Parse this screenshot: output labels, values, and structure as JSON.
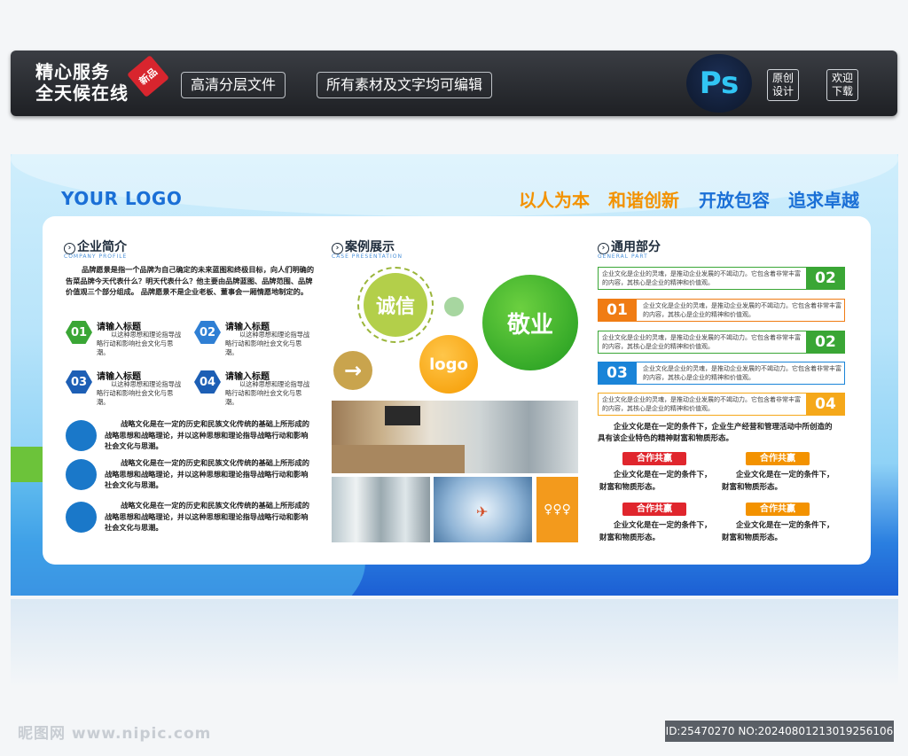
{
  "topbar": {
    "slogan1": "精心服务",
    "slogan2": "全天候在线",
    "new_badge": "新品",
    "pill1": "高清分层文件",
    "pill2": "所有素材及文字均可编辑",
    "ps": "Ps",
    "btn_original_1": "原创",
    "btn_original_2": "设计",
    "btn_download_1": "欢迎",
    "btn_download_2": "下载"
  },
  "board": {
    "logo": "YOUR LOGO",
    "slogans": [
      "以人为本",
      "和谐创新",
      "开放包容",
      "追求卓越"
    ],
    "slogan_colors": [
      "#f39200",
      "#f39200",
      "#1a6fd6",
      "#1a6fd6"
    ]
  },
  "left": {
    "title": "企业简介",
    "subtitle": "COMPANY PROFILE",
    "intro": "品牌愿景是指一个品牌为自己确定的未来蓝图和终极目标，向人们明确的告菜品牌今天代表什么？明天代表什么？他主要由品牌蓝图、品牌范围、品牌价值观三个部分组成。 品牌愿景不是企业老板、董事会一厢情愿地制定的。",
    "items": [
      {
        "num": "01",
        "title": "请输入标题",
        "body": "以这种思想和理论指导战略行动和影响社会文化与思潮。",
        "color": "#3aa635"
      },
      {
        "num": "02",
        "title": "请输入标题",
        "body": "以这种思想和理论指导战略行动和影响社会文化与思潮。",
        "color": "#2f7fd4"
      },
      {
        "num": "03",
        "title": "请输入标题",
        "body": "以这种思想和理论指导战略行动和影响社会文化与思潮。",
        "color": "#1d5fb5"
      },
      {
        "num": "04",
        "title": "请输入标题",
        "body": "以这种思想和理论指导战略行动和影响社会文化与思潮。",
        "color": "#1d5fb5"
      }
    ],
    "paras": [
      "战略文化是在一定的历史和民族文化传统的基础上所形成的战略思想和战略理论，并以这种思想和理论指导战略行动和影响社会文化与思潮。",
      "战略文化是在一定的历史和民族文化传统的基础上所形成的战略思想和战略理论，并以这种思想和理论指导战略行动和影响社会文化与思潮。",
      "战略文化是在一定的历史和民族文化传统的基础上所形成的战略思想和战略理论，并以这种思想和理论指导战略行动和影响社会文化与思潮。"
    ]
  },
  "middle": {
    "title": "案例展示",
    "subtitle": "CASE PRESENTATION",
    "circle1": "诚信",
    "circle2": "敬业",
    "circle3": "logo",
    "arrow": "→"
  },
  "right": {
    "title": "通用部分",
    "subtitle": "GENERAL PART",
    "boxes": [
      {
        "num": "02",
        "text": "企业文化是企业的灵魂，是推动企业发展的不竭动力。它包含着非常丰富的内容，其核心是企业的精神和价值观。",
        "color": "#3aa635",
        "side": "right"
      },
      {
        "num": "01",
        "text": "企业文化是企业的灵魂，是推动企业发展的不竭动力。它包含着非常丰富的内容，其核心是企业的精神和价值观。",
        "color": "#f07c14",
        "side": "left"
      },
      {
        "num": "02",
        "text": "企业文化是企业的灵魂，是推动企业发展的不竭动力。它包含着非常丰富的内容，其核心是企业的精神和价值观。",
        "color": "#3aa635",
        "side": "right"
      },
      {
        "num": "03",
        "text": "企业文化是企业的灵魂，是推动企业发展的不竭动力。它包含着非常丰富的内容，其核心是企业的精神和价值观。",
        "color": "#1a84d8",
        "side": "left"
      },
      {
        "num": "04",
        "text": "企业文化是企业的灵魂，是推动企业发展的不竭动力。它包含着非常丰富的内容，其核心是企业的精神和价值观。",
        "color": "#f5a81a",
        "side": "right"
      }
    ],
    "summary": "企业文化是在一定的条件下，企业生产经营和管理活动中所创造的具有该企业特色的精神财富和物质形态。",
    "tags": [
      {
        "label": "合作共赢",
        "body": "企业文化是在一定的条件下，财富和物质形态。",
        "color": "#e0262d"
      },
      {
        "label": "合作共赢",
        "body": "企业文化是在一定的条件下，财富和物质形态。",
        "color": "#f39200"
      },
      {
        "label": "合作共赢",
        "body": "企业文化是在一定的条件下，财富和物质形态。",
        "color": "#e0262d"
      },
      {
        "label": "合作共赢",
        "body": "企业文化是在一定的条件下，财富和物质形态。",
        "color": "#f39200"
      }
    ]
  },
  "watermark": {
    "left": "昵图网 www.nipic.com",
    "right": "ID:25470270 NO:20240801213019256106"
  }
}
